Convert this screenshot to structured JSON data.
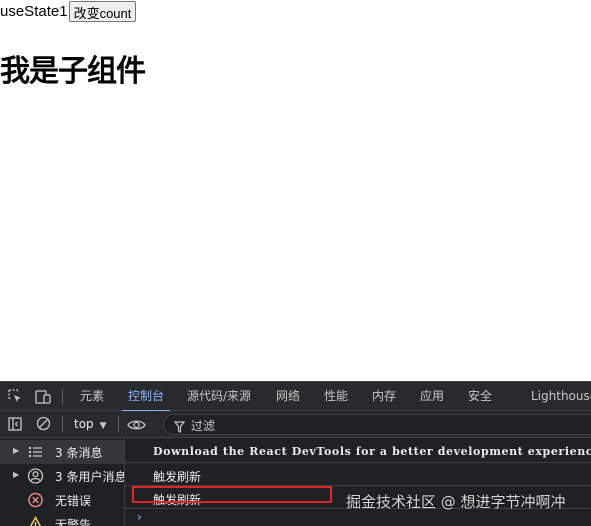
{
  "page": {
    "count_text": "useState1",
    "change_button_label": "改变count",
    "child_heading": "我是子组件"
  },
  "devtools": {
    "tabs": [
      {
        "label": "元素",
        "active": false
      },
      {
        "label": "控制台",
        "active": true
      },
      {
        "label": "源代码/来源",
        "active": false
      },
      {
        "label": "网络",
        "active": false
      },
      {
        "label": "性能",
        "active": false
      },
      {
        "label": "内存",
        "active": false
      },
      {
        "label": "应用",
        "active": false
      },
      {
        "label": "安全",
        "active": false
      },
      {
        "label": "Lighthouse",
        "active": false
      }
    ],
    "toolbar": {
      "context": "top",
      "filter_placeholder": "过滤"
    },
    "sidebar": [
      {
        "label": "3 条消息",
        "icon": "list-icon",
        "expandable": true,
        "selected": true
      },
      {
        "label": "3 条用户消息",
        "icon": "user-icon",
        "expandable": true,
        "selected": false
      },
      {
        "label": "无错误",
        "icon": "error-icon",
        "expandable": false,
        "selected": false
      },
      {
        "label": "无警告",
        "icon": "warning-icon",
        "expandable": false,
        "selected": false
      }
    ],
    "console_messages": [
      {
        "text": "Download the React DevTools for a better development experience: https://reactjs.org/link/react-devtools",
        "styled": true
      },
      {
        "text": "触发刷新",
        "styled": false
      },
      {
        "text": "触发刷新",
        "styled": false
      }
    ],
    "prompt": "›"
  },
  "watermark": "掘金技术社区 @ 想进字节冲啊冲",
  "colors": {
    "accent": "#8ab4f8",
    "highlight": "#e0242b",
    "error": "#f28b82",
    "warning": "#fdd663"
  }
}
